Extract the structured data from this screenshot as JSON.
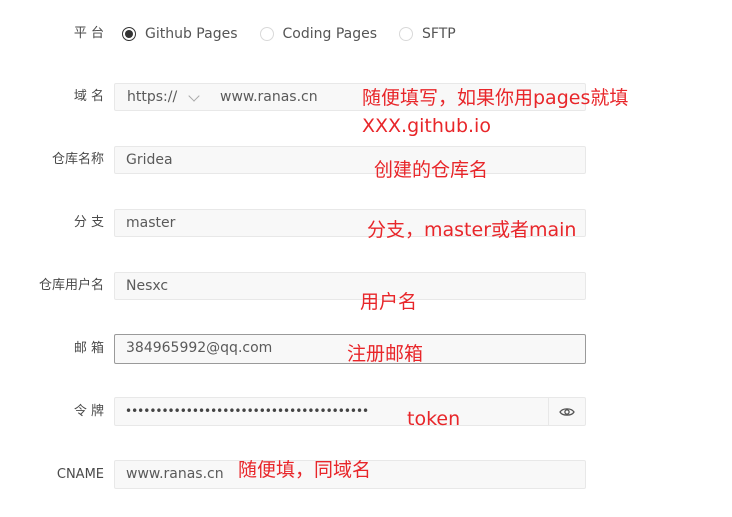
{
  "form": {
    "platform": {
      "label": "平 台",
      "options": [
        "Github Pages",
        "Coding Pages",
        "SFTP"
      ],
      "selected": "Github Pages"
    },
    "domain": {
      "label": "域 名",
      "protocol": "https://",
      "value": "www.ranas.cn"
    },
    "repo": {
      "label": "仓库名称",
      "value": "Gridea"
    },
    "branch": {
      "label": "分 支",
      "value": "master"
    },
    "username": {
      "label": "仓库用户名",
      "value": "Nesxc"
    },
    "email": {
      "label": "邮 箱",
      "value": "384965992@qq.com"
    },
    "token": {
      "label": "令 牌",
      "masked_value": "••••••••••••••••••••••••••••••••••••••••"
    },
    "cname": {
      "label": "CNAME",
      "value": "www.ranas.cn"
    }
  },
  "annotations": {
    "domain_line1": "随便填写，如果你用pages就填",
    "domain_line2": "XXX.github.io",
    "repo": "创建的仓库名",
    "branch": "分支，master或者main",
    "username": "用户名",
    "email": "注册邮箱",
    "token": "token",
    "cname": "随便填，同域名"
  },
  "icons": {
    "protocol_dropdown": "chevron-down-icon",
    "token_toggle": "eye-icon"
  },
  "colors": {
    "annotation": "#e8262a",
    "radio_checked": "#333333",
    "field_bg": "#f8f8f8",
    "field_border": "#e8e8e8"
  }
}
